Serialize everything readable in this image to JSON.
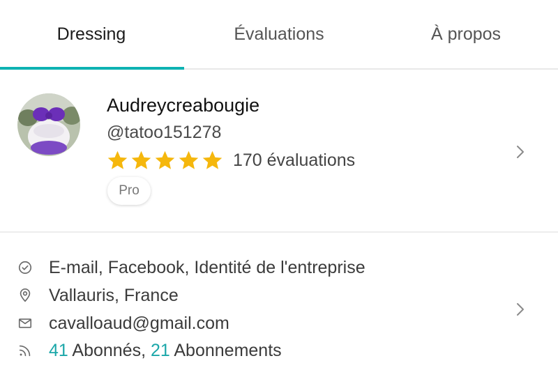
{
  "tabs": [
    {
      "label": "Dressing",
      "active": true
    },
    {
      "label": "Évaluations",
      "active": false
    },
    {
      "label": "À propos",
      "active": false
    }
  ],
  "profile": {
    "username": "Audreycreabougie",
    "handle": "@tatoo151278",
    "rating_stars": 5,
    "reviews_label": "170 évaluations",
    "badge": "Pro",
    "avatar_icon": "avatar-photo-candle"
  },
  "details": {
    "verified": "E-mail, Facebook, Identité de l'entreprise",
    "location": "Vallauris, France",
    "email": "cavalloaud@gmail.com",
    "followers_count": "41",
    "followers_label": "Abonnés,",
    "following_count": "21",
    "following_label": "Abonnements"
  },
  "colors": {
    "accent": "#0eb2b2",
    "link": "#1ba7a9",
    "star": "#f5b70d"
  }
}
